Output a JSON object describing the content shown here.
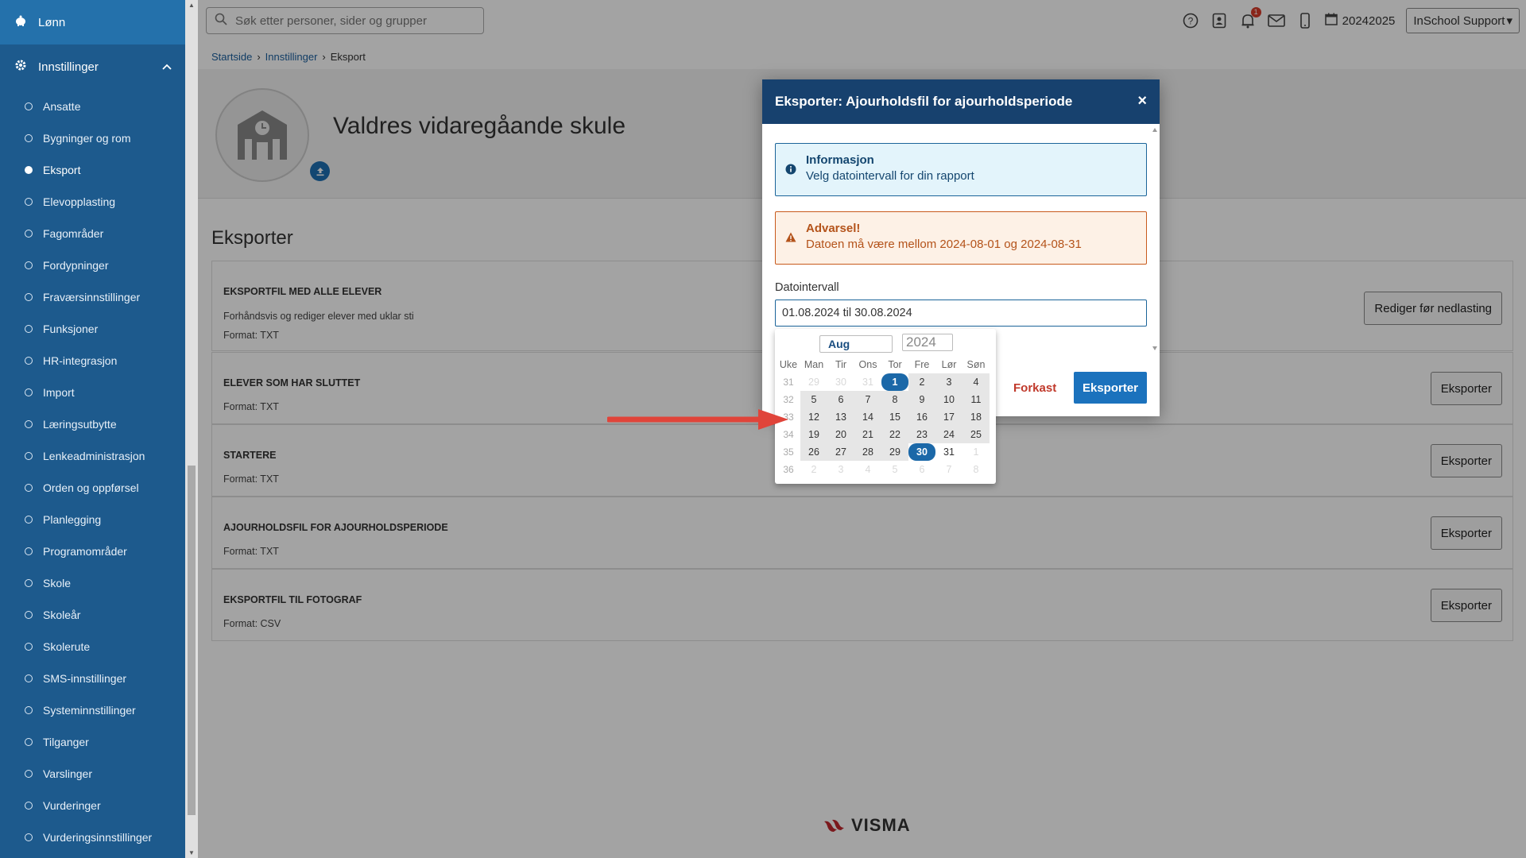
{
  "sidebar": {
    "top_item": "Lønn",
    "section": "Innstillinger",
    "items": [
      {
        "label": "Ansatte",
        "active": false
      },
      {
        "label": "Bygninger og rom",
        "active": false
      },
      {
        "label": "Eksport",
        "active": true
      },
      {
        "label": "Elevopplasting",
        "active": false
      },
      {
        "label": "Fagområder",
        "active": false
      },
      {
        "label": "Fordypninger",
        "active": false
      },
      {
        "label": "Fraværsinnstillinger",
        "active": false
      },
      {
        "label": "Funksjoner",
        "active": false
      },
      {
        "label": "HR-integrasjon",
        "active": false
      },
      {
        "label": "Import",
        "active": false
      },
      {
        "label": "Læringsutbytte",
        "active": false
      },
      {
        "label": "Lenkeadministrasjon",
        "active": false
      },
      {
        "label": "Orden og oppførsel",
        "active": false
      },
      {
        "label": "Planlegging",
        "active": false
      },
      {
        "label": "Programområder",
        "active": false
      },
      {
        "label": "Skole",
        "active": false
      },
      {
        "label": "Skoleår",
        "active": false
      },
      {
        "label": "Skolerute",
        "active": false
      },
      {
        "label": "SMS-innstillinger",
        "active": false
      },
      {
        "label": "Systeminnstillinger",
        "active": false
      },
      {
        "label": "Tilganger",
        "active": false
      },
      {
        "label": "Varslinger",
        "active": false
      },
      {
        "label": "Vurderinger",
        "active": false
      },
      {
        "label": "Vurderingsinnstillinger",
        "active": false
      }
    ]
  },
  "topbar": {
    "search_placeholder": "Søk etter personer, sider og grupper",
    "notification_count": "1",
    "period": "20242025",
    "user_menu": "InSchool Support"
  },
  "breadcrumb": {
    "home": "Startside",
    "settings": "Innstillinger",
    "current": "Eksport"
  },
  "page": {
    "school_name": "Valdres vidaregåande skule",
    "section_title": "Eksporter"
  },
  "exports": [
    {
      "title": "EKSPORTFIL MED ALLE ELEVER",
      "desc": "Forhåndsvis og rediger elever med uklar sti",
      "format": "Format: TXT",
      "button": "Rediger før nedlasting"
    },
    {
      "title": "ELEVER SOM HAR SLUTTET",
      "format": "Format: TXT",
      "button": "Eksporter"
    },
    {
      "title": "STARTERE",
      "format": "Format: TXT",
      "button": "Eksporter"
    },
    {
      "title": "AJOURHOLDSFIL FOR AJOURHOLDSPERIODE",
      "format": "Format: TXT",
      "button": "Eksporter"
    },
    {
      "title": "EKSPORTFIL TIL FOTOGRAF",
      "format": "Format: CSV",
      "button": "Eksporter"
    }
  ],
  "footer_logo": "VISMA",
  "modal": {
    "title": "Eksporter: Ajourholdsfil for ajourholdsperiode",
    "close": "×",
    "info_heading": "Informasjon",
    "info_text": "Velg datointervall for din rapport",
    "warn_heading": "Advarsel!",
    "warn_text": "Datoen må være mellom 2024-08-01 og 2024-08-31",
    "date_label": "Datointervall",
    "date_value": "01.08.2024 til 30.08.2024",
    "cancel": "Forkast",
    "export": "Eksporter"
  },
  "calendar": {
    "month": "Aug",
    "year": "2024",
    "headers": [
      "Uke",
      "Man",
      "Tir",
      "Ons",
      "Tor",
      "Fre",
      "Lør",
      "Søn"
    ],
    "weeks": [
      {
        "wk": "31",
        "days": [
          {
            "d": "29",
            "s": "out"
          },
          {
            "d": "30",
            "s": "out"
          },
          {
            "d": "31",
            "s": "out"
          },
          {
            "d": "1",
            "s": "sel"
          },
          {
            "d": "2",
            "s": "inr"
          },
          {
            "d": "3",
            "s": "inr"
          },
          {
            "d": "4",
            "s": "inr"
          }
        ]
      },
      {
        "wk": "32",
        "days": [
          {
            "d": "5",
            "s": "inr"
          },
          {
            "d": "6",
            "s": "inr"
          },
          {
            "d": "7",
            "s": "inr"
          },
          {
            "d": "8",
            "s": "inr"
          },
          {
            "d": "9",
            "s": "inr"
          },
          {
            "d": "10",
            "s": "inr"
          },
          {
            "d": "11",
            "s": "inr"
          }
        ]
      },
      {
        "wk": "33",
        "days": [
          {
            "d": "12",
            "s": "inr"
          },
          {
            "d": "13",
            "s": "inr"
          },
          {
            "d": "14",
            "s": "inr"
          },
          {
            "d": "15",
            "s": "inr"
          },
          {
            "d": "16",
            "s": "inr"
          },
          {
            "d": "17",
            "s": "inr"
          },
          {
            "d": "18",
            "s": "inr"
          }
        ]
      },
      {
        "wk": "34",
        "days": [
          {
            "d": "19",
            "s": "inr"
          },
          {
            "d": "20",
            "s": "inr"
          },
          {
            "d": "21",
            "s": "inr"
          },
          {
            "d": "22",
            "s": "inr"
          },
          {
            "d": "23",
            "s": "inr"
          },
          {
            "d": "24",
            "s": "inr"
          },
          {
            "d": "25",
            "s": "inr"
          }
        ]
      },
      {
        "wk": "35",
        "days": [
          {
            "d": "26",
            "s": "inr"
          },
          {
            "d": "27",
            "s": "inr"
          },
          {
            "d": "28",
            "s": "inr"
          },
          {
            "d": "29",
            "s": "inr"
          },
          {
            "d": "30",
            "s": "sel"
          },
          {
            "d": "31",
            "s": ""
          },
          {
            "d": "1",
            "s": "out"
          }
        ]
      },
      {
        "wk": "36",
        "days": [
          {
            "d": "2",
            "s": "out"
          },
          {
            "d": "3",
            "s": "out"
          },
          {
            "d": "4",
            "s": "out"
          },
          {
            "d": "5",
            "s": "out"
          },
          {
            "d": "6",
            "s": "out"
          },
          {
            "d": "7",
            "s": "out"
          },
          {
            "d": "8",
            "s": "out"
          }
        ]
      }
    ]
  },
  "colors": {
    "sidebar": "#1d5a8d",
    "modal_header": "#17416e",
    "primary": "#1b72bd",
    "annotation_arrow": "#e0443a"
  }
}
